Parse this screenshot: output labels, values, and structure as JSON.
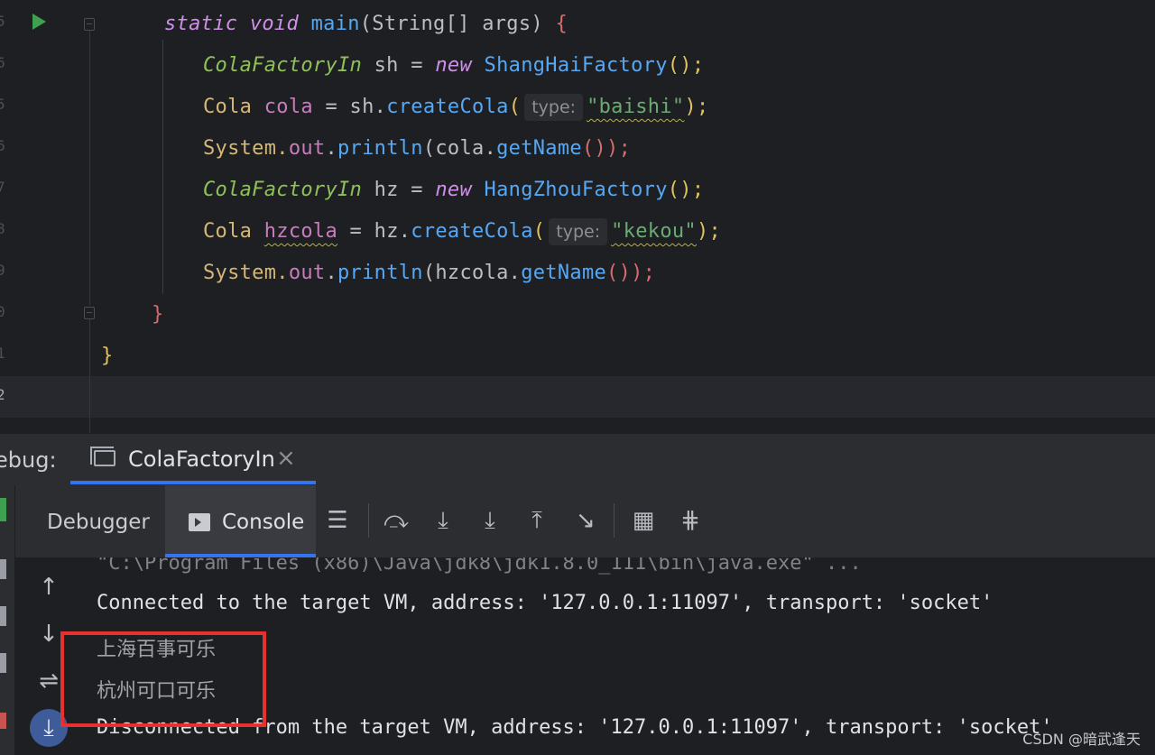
{
  "editor": {
    "gutter_numbers": [
      "5",
      "6",
      "5",
      "6",
      "7",
      "8",
      "9",
      "0",
      "1",
      "2"
    ],
    "code": {
      "main_kw_static": "static",
      "main_kw_void": "void",
      "main_name": "main",
      "main_params": "(String[] args) ",
      "main_open_brace": "{",
      "l2_type": "ColaFactoryIn",
      "l2_var": " sh = ",
      "l2_new": "new",
      "l2_class": " ShangHaiFactory",
      "l2_tail": "();",
      "l3_type": "Cola",
      "l3_var": " cola",
      "l3_eq": " = sh.",
      "l3_fn": "createCola",
      "l3_paren": "(",
      "l3_hint": "type:",
      "l3_str": "\"baishi\"",
      "l3_tail": ");",
      "l4_pre": "System.",
      "l4_out": "out",
      "l4_dot": ".",
      "l4_fn": "println",
      "l4_mid": "(cola.",
      "l4_fn2": "getName",
      "l4_tail": "());",
      "l5_type": "ColaFactoryIn",
      "l5_var": " hz = ",
      "l5_new": "new",
      "l5_class": " HangZhouFactory",
      "l5_tail": "();",
      "l6_type": "Cola",
      "l6_var": "hzcola",
      "l6_eq": " = hz.",
      "l6_fn": "createCola",
      "l6_paren": "(",
      "l6_hint": "type:",
      "l6_str": "\"kekou\"",
      "l6_tail": ");",
      "l7_pre": "System.",
      "l7_out": "out",
      "l7_dot": ".",
      "l7_fn": "println",
      "l7_mid": "(hzcola.",
      "l7_fn2": "getName",
      "l7_tail": "());",
      "close_method": "}",
      "close_class": "}"
    }
  },
  "debug": {
    "label": "ebug:",
    "tab_label": "ColaFactoryIn",
    "tab_close": "×",
    "debugger_tab": "Debugger",
    "console_tab": "Console",
    "toolbar_icons": [
      "menu-icon",
      "show-execution-point-icon",
      "step-over-icon",
      "step-into-icon",
      "step-out-icon",
      "run-to-cursor-icon",
      "evaluate-expression-icon",
      "trace-icon"
    ]
  },
  "console": {
    "lines": [
      "\"C:\\Program Files (x86)\\Java\\jdk8\\jdk1.8.0_111\\bin\\java.exe\" ...",
      "Connected to the target VM, address: '127.0.0.1:11097', transport: 'socket'",
      "上海百事可乐",
      "杭州可口可乐",
      "Disconnected from the target VM, address: '127.0.0.1:11097', transport: 'socket'"
    ]
  },
  "watermark": "CSDN @暗武逢天",
  "colors": {
    "accent": "#3574f0",
    "highlight_box": "#e8312f",
    "run_icon": "#3fa14f"
  }
}
